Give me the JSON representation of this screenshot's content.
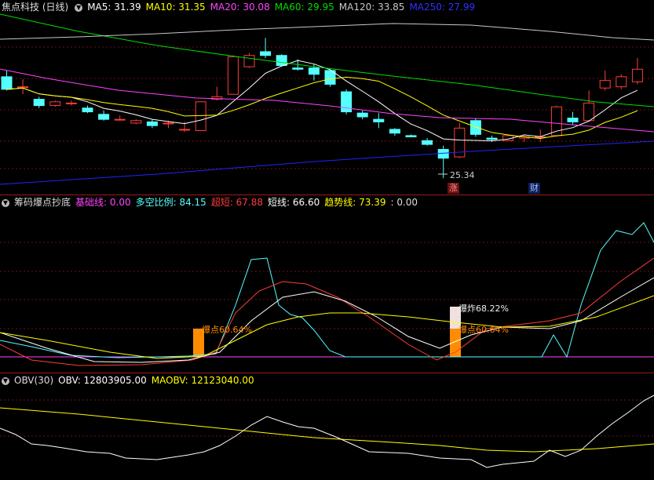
{
  "main": {
    "title": "焦点科技 (日线)",
    "ma5": "MA5: 31.39",
    "ma10": "MA10: 31.35",
    "ma20": "MA20: 30.08",
    "ma60": "MA60: 29.95",
    "ma120": "MA120: 33.85",
    "ma250": "MA250: 27.99",
    "low_label": "25.34",
    "tag_zhang": "涨",
    "tag_cai": "财"
  },
  "indicator": {
    "title": "筹码爆点抄底",
    "base": "基础线: 0.00",
    "longshort": "多空比例: 84.15",
    "super": "超短: 67.88",
    "short": "短线: 66.60",
    "trend": "趋势线: 73.39",
    "extra": ": 0.00",
    "burst1": "爆点60.64%",
    "burst2": "爆点60.64%",
    "explode": "爆炸68.22%"
  },
  "obv": {
    "title": "OBV(30)",
    "obv": "OBV: 12803905.00",
    "maobv": "MAOBV: 12123040.00"
  },
  "colors": {
    "ma5": "#ffffff",
    "ma10": "#ffff00",
    "ma20": "#ff44ff",
    "ma60": "#00dd00",
    "ma120": "#c8c8c8",
    "ma250": "#2222ff",
    "up": "#ff3b3b",
    "down": "#54ffff",
    "burst": "#ff8c00",
    "explode": "#f0e0e0"
  },
  "chart_data": {
    "type": "candlestick",
    "candles": [
      {
        "o": 33.4,
        "h": 33.9,
        "c": 32.4,
        "l": 32.3
      },
      {
        "o": 32.6,
        "h": 33.2,
        "c": 32.6,
        "l": 32.0
      },
      {
        "o": 31.6,
        "h": 31.8,
        "c": 31.1,
        "l": 30.9
      },
      {
        "o": 31.1,
        "h": 31.5,
        "c": 31.4,
        "l": 31.0
      },
      {
        "o": 31.3,
        "h": 31.5,
        "c": 31.3,
        "l": 31.1
      },
      {
        "o": 30.9,
        "h": 31.1,
        "c": 30.6,
        "l": 30.5
      },
      {
        "o": 30.4,
        "h": 30.7,
        "c": 30.0,
        "l": 29.9
      },
      {
        "o": 30.0,
        "h": 30.3,
        "c": 30.0,
        "l": 29.9
      },
      {
        "o": 29.7,
        "h": 30.0,
        "c": 29.9,
        "l": 29.6
      },
      {
        "o": 29.8,
        "h": 30.0,
        "c": 29.5,
        "l": 29.3
      },
      {
        "o": 29.7,
        "h": 29.9,
        "c": 29.7,
        "l": 29.3
      },
      {
        "o": 29.2,
        "h": 29.8,
        "c": 29.2,
        "l": 29.0
      },
      {
        "o": 29.1,
        "h": 31.4,
        "c": 31.4,
        "l": 29.1
      },
      {
        "o": 31.6,
        "h": 32.6,
        "c": 31.8,
        "l": 31.5
      },
      {
        "o": 32.0,
        "h": 35.1,
        "c": 35.0,
        "l": 32.0
      },
      {
        "o": 34.2,
        "h": 35.3,
        "c": 35.1,
        "l": 34.1
      },
      {
        "o": 35.4,
        "h": 36.5,
        "c": 35.1,
        "l": 34.9
      },
      {
        "o": 35.1,
        "h": 35.2,
        "c": 34.3,
        "l": 34.2
      },
      {
        "o": 34.1,
        "h": 34.8,
        "c": 34.0,
        "l": 33.9
      },
      {
        "o": 34.1,
        "h": 34.4,
        "c": 33.6,
        "l": 33.1
      },
      {
        "o": 33.9,
        "h": 34.0,
        "c": 32.8,
        "l": 32.6
      },
      {
        "o": 32.2,
        "h": 32.4,
        "c": 30.6,
        "l": 30.4
      },
      {
        "o": 30.5,
        "h": 30.7,
        "c": 30.2,
        "l": 30.0
      },
      {
        "o": 30.0,
        "h": 30.5,
        "c": 29.8,
        "l": 29.3
      },
      {
        "o": 29.2,
        "h": 29.3,
        "c": 28.9,
        "l": 28.7
      },
      {
        "o": 28.7,
        "h": 28.8,
        "c": 28.6,
        "l": 28.6
      },
      {
        "o": 28.3,
        "h": 28.5,
        "c": 28.0,
        "l": 27.9
      },
      {
        "o": 27.6,
        "h": 27.9,
        "c": 26.9,
        "l": 25.3
      },
      {
        "o": 27.0,
        "h": 29.7,
        "c": 29.3,
        "l": 26.9
      },
      {
        "o": 29.9,
        "h": 30.1,
        "c": 28.8,
        "l": 28.6
      },
      {
        "o": 28.5,
        "h": 28.7,
        "c": 28.4,
        "l": 28.2
      },
      {
        "o": 28.3,
        "h": 28.8,
        "c": 28.7,
        "l": 28.3
      },
      {
        "o": 28.5,
        "h": 28.8,
        "c": 28.6,
        "l": 28.2
      },
      {
        "o": 28.6,
        "h": 29.2,
        "c": 28.6,
        "l": 28.2
      },
      {
        "o": 28.7,
        "h": 31.1,
        "c": 31.0,
        "l": 28.6
      },
      {
        "o": 30.1,
        "h": 30.6,
        "c": 29.8,
        "l": 29.6
      },
      {
        "o": 29.9,
        "h": 32.3,
        "c": 31.3,
        "l": 29.8
      },
      {
        "o": 32.5,
        "h": 33.9,
        "c": 33.1,
        "l": 32.3
      },
      {
        "o": 32.6,
        "h": 33.6,
        "c": 33.4,
        "l": 32.4
      },
      {
        "o": 33.0,
        "h": 34.9,
        "c": 34.0,
        "l": 32.8
      }
    ],
    "ylim": [
      24.5,
      38.4
    ]
  }
}
